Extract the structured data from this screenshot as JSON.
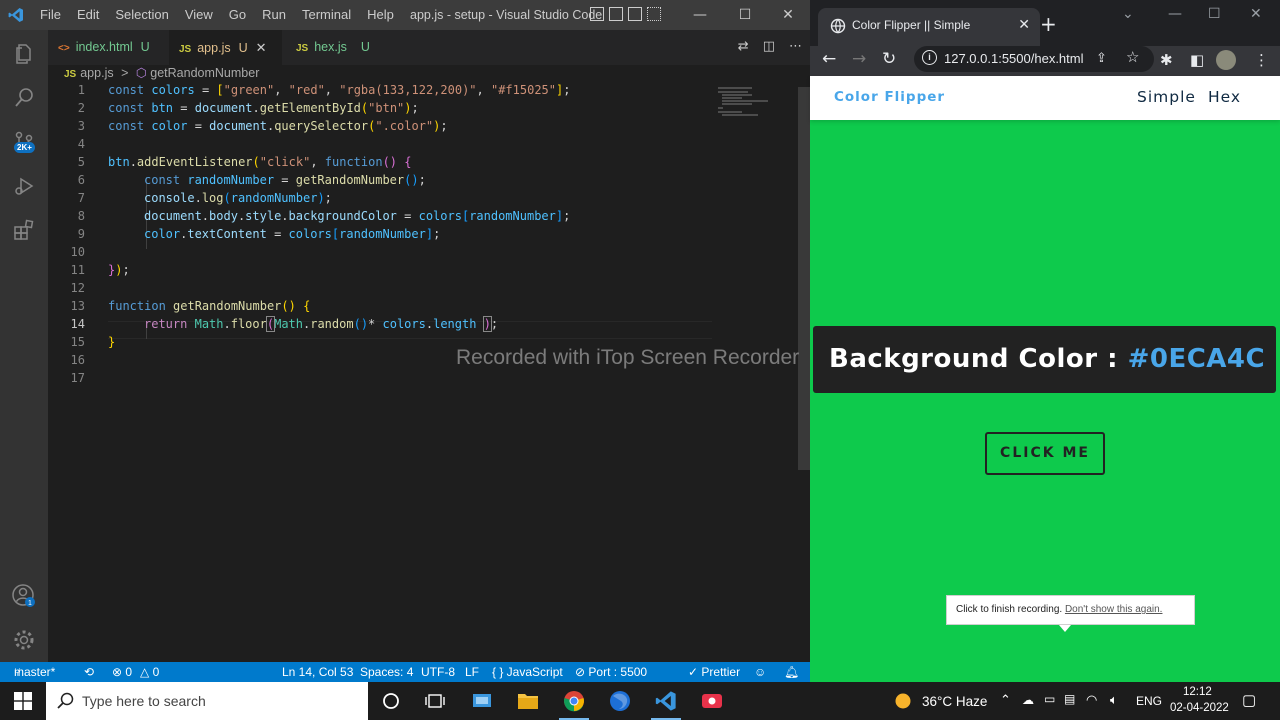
{
  "vscode": {
    "menu": [
      "File",
      "Edit",
      "Selection",
      "View",
      "Go",
      "Run",
      "Terminal",
      "Help"
    ],
    "window_title": "app.js - setup - Visual Studio Code",
    "tabs": [
      {
        "icon": "<>",
        "name": "index.html",
        "status": "U"
      },
      {
        "icon": "JS",
        "name": "app.js",
        "status": "U",
        "close": "✕"
      },
      {
        "icon": "JS",
        "name": "hex.js",
        "status": "U"
      }
    ],
    "breadcrumb": {
      "file_icon": "JS",
      "file": "app.js",
      "separator": ">",
      "symbol": "getRandomNumber"
    },
    "activity_badge": "2K+",
    "line_numbers": [
      "1",
      "2",
      "3",
      "4",
      "5",
      "6",
      "7",
      "8",
      "9",
      "10",
      "11",
      "12",
      "13",
      "14",
      "15",
      "16",
      "17"
    ],
    "code": {
      "l1": {
        "kw": "const",
        "name": "colors",
        "eq": " = ",
        "b1": "[",
        "s1": "\"green\"",
        "c1": ", ",
        "s2": "\"red\"",
        "c2": ", ",
        "s3": "\"rgba(133,122,200)\"",
        "c3": ", ",
        "s4": "\"#f15025\"",
        "b2": "]",
        "end": ";"
      },
      "l2": {
        "kw": "const",
        "name": "btn",
        "eq": " = ",
        "obj": "document",
        "dot": ".",
        "fn": "getElementById",
        "p1": "(",
        "s": "\"btn\"",
        "p2": ")",
        "end": ";"
      },
      "l3": {
        "kw": "const",
        "name": "color",
        "eq": " = ",
        "obj": "document",
        "dot": ".",
        "fn": "querySelector",
        "p1": "(",
        "s": "\".color\"",
        "p2": ")",
        "end": ";"
      },
      "l5": {
        "obj": "btn",
        "dot": ".",
        "fn": "addEventListener",
        "p1": "(",
        "s": "\"click\"",
        "c": ", ",
        "kw": "function",
        "p2": "()",
        "sp": " ",
        "b": "{"
      },
      "l6": {
        "kw": "const",
        "name": "randomNumber",
        "eq": " = ",
        "fn": "getRandomNumber",
        "p": "()",
        "end": ";"
      },
      "l7": {
        "obj": "console",
        "dot": ".",
        "fn": "log",
        "p1": "(",
        "arg": "randomNumber",
        "p2": ")",
        "end": ";"
      },
      "l8": {
        "o1": "document",
        "d1": ".",
        "o2": "body",
        "d2": ".",
        "o3": "style",
        "d3": ".",
        "o4": "backgroundColor",
        "eq": " = ",
        "arr": "colors",
        "b1": "[",
        "idx": "randomNumber",
        "b2": "]",
        "end": ";"
      },
      "l9": {
        "o1": "color",
        "d1": ".",
        "o2": "textContent",
        "eq": " = ",
        "arr": "colors",
        "b1": "[",
        "idx": "randomNumber",
        "b2": "]",
        "end": ";"
      },
      "l11": {
        "b": "}",
        "p": ")",
        "end": ";"
      },
      "l13": {
        "kw": "function",
        "sp": " ",
        "fn": "getRandomNumber",
        "p": "()",
        "sp2": " ",
        "b": "{"
      },
      "l14": {
        "kw": "return",
        "sp": " ",
        "cls": "Math",
        "d1": ".",
        "fn": "floor",
        "p1": "(",
        "cls2": "Math",
        "d2": ".",
        "fn2": "random",
        "p2": "()",
        "op": "* ",
        "arr": "colors",
        "d3": ".",
        "len": "length",
        "sp3": " ",
        "p3": ")",
        "end": ";"
      },
      "l15": {
        "b": "}"
      }
    },
    "status": {
      "branch": "master*",
      "live_share_icon": "⟲",
      "errors": "⊗ 0",
      "warnings": "△ 0",
      "position": "Ln 14, Col 53",
      "spaces": "Spaces: 4",
      "encoding": "UTF-8",
      "eol": "LF",
      "language": "{ } JavaScript",
      "port": "⊘ Port : 5500",
      "prettier": "✓ Prettier"
    }
  },
  "watermark": "Recorded with iTop Screen Recorder",
  "chrome": {
    "tab_title": "Color Flipper || Simple",
    "tab_close": "✕",
    "new_tab": "+",
    "url": "127.0.0.1:5500/hex.html",
    "page": {
      "brand": "Color Flipper",
      "nav_links": [
        "Simple",
        "Hex"
      ],
      "bg_label": "Background Color : ",
      "bg_value": "#0ECA4C",
      "button": "CLICK ME",
      "tooltip_text": "Click to finish recording.",
      "tooltip_link": "Don't show this again."
    },
    "bg_color": "#0eca4c"
  },
  "taskbar": {
    "search_placeholder": "Type here to search",
    "weather": "36°C  Haze",
    "language": "ENG",
    "time": "12:12",
    "date": "02-04-2022"
  }
}
